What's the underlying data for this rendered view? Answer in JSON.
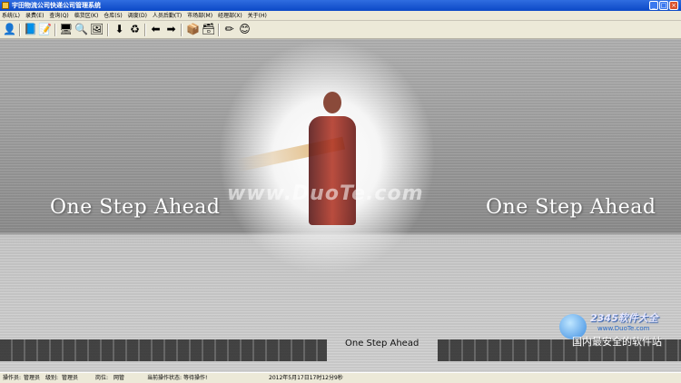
{
  "window": {
    "title": "宇田物流公司快递公司管理系统",
    "minimize": "_",
    "maximize": "□",
    "close": "×"
  },
  "menu": [
    "系统(L)",
    "录费(E)",
    "查询(Q)",
    "临货区(K)",
    "仓库(S)",
    "调度(D)",
    "人员后勤(T)",
    "市场部(M)",
    "经理部(X)",
    "关于(H)"
  ],
  "toolbar": {
    "icons": [
      "user-icon",
      "book-icon",
      "notepad-icon",
      "monitor-icon",
      "search-icon",
      "image-icon",
      "download-icon",
      "refresh-icon",
      "back-icon",
      "forward-icon",
      "box-icon",
      "boxes-icon",
      "pencil-icon",
      "smile-icon"
    ]
  },
  "banner": {
    "slogan_left": "One Step Ahead",
    "slogan_right": "One Step Ahead",
    "watermark": "www.DuoTe.com",
    "sub_slogan": "One Step Ahead"
  },
  "site_logo": {
    "brand": "2345软件大全",
    "url": "www.DuoTe.com",
    "caption": "国内最安全的软件站"
  },
  "status": {
    "operator_label": "操作员:",
    "operator_value": "管理员",
    "level_label": "级别:",
    "level_value": "管理员",
    "position_label": "岗位:",
    "position_value": "网管",
    "state_label": "当前操作状态:",
    "state_value": "等待操作!",
    "datetime": "2012年5月17日17时12分9秒"
  }
}
